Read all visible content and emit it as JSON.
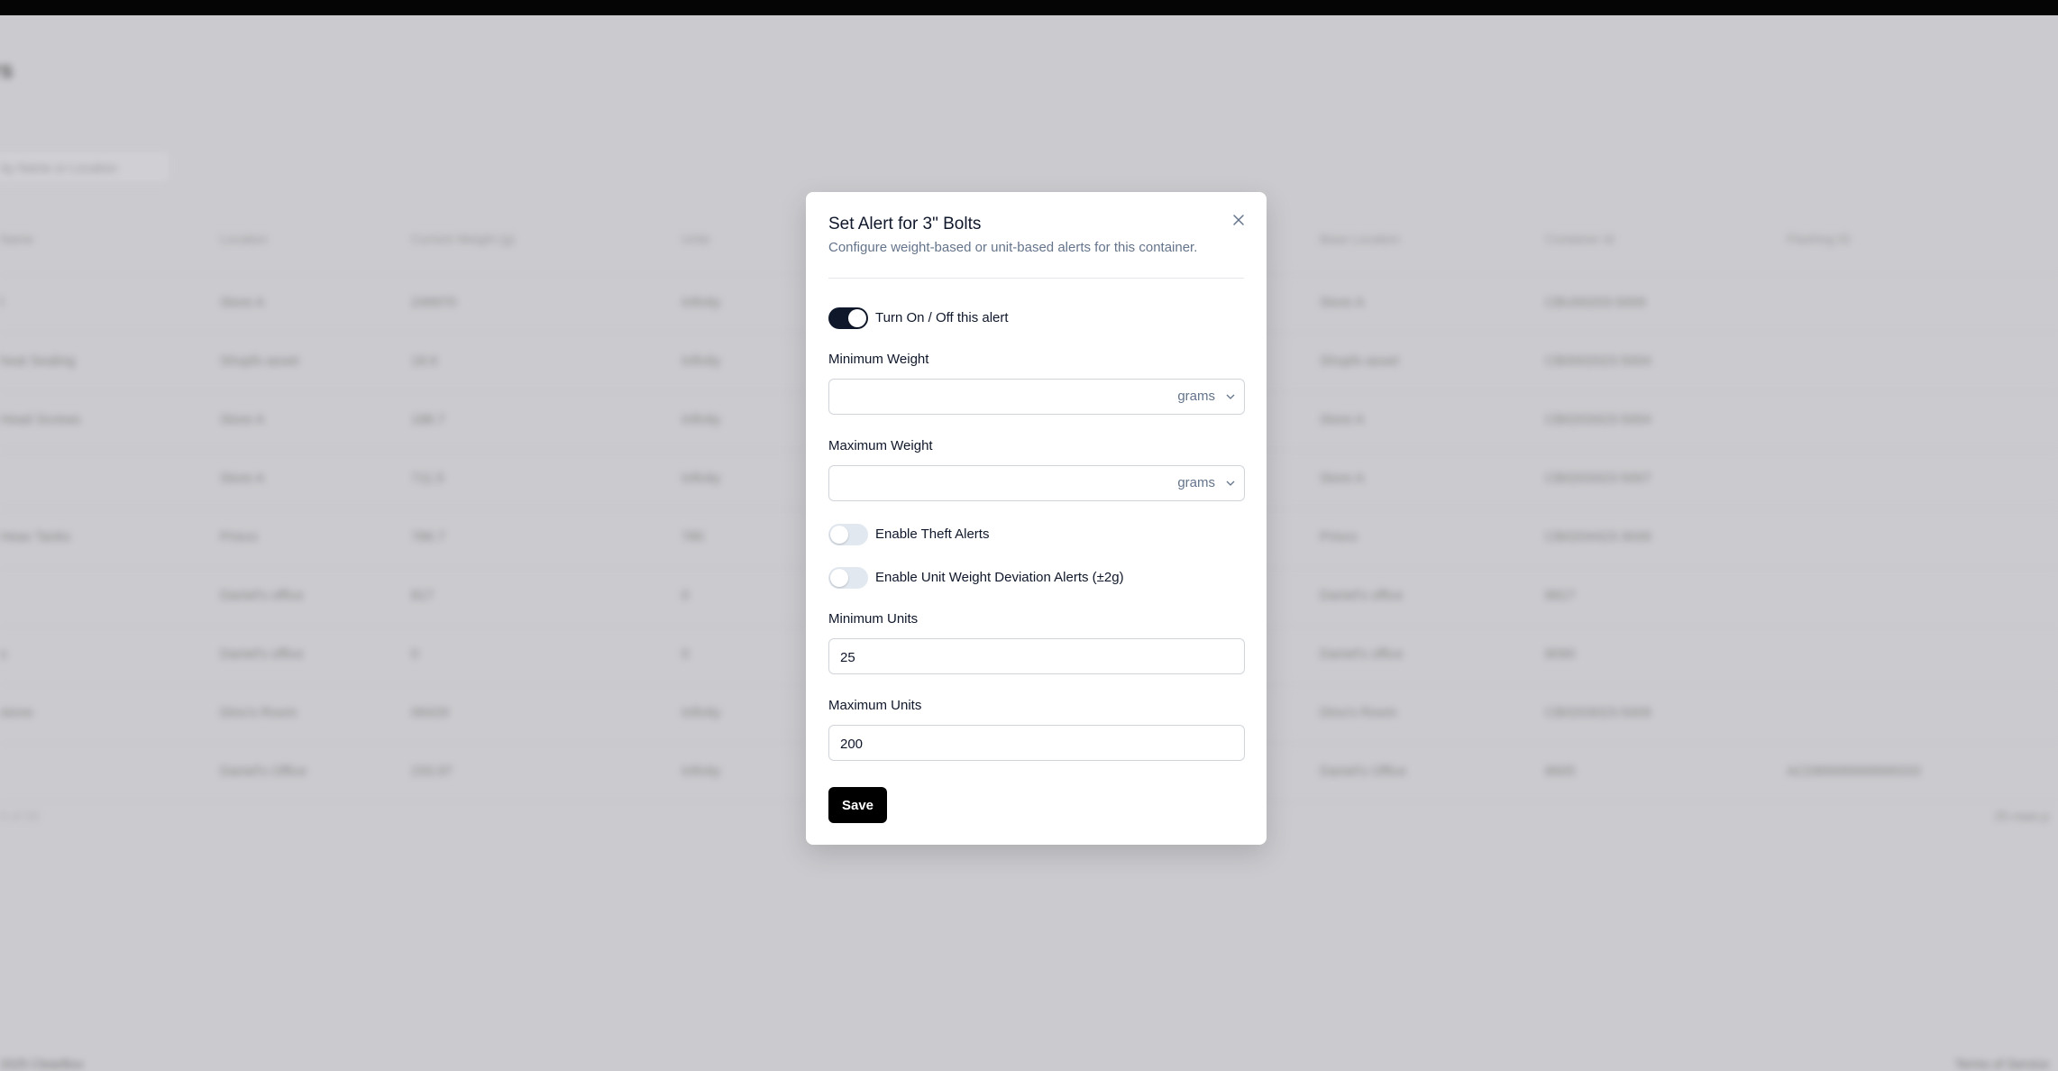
{
  "background": {
    "page_title": "rs",
    "search_placeholder": "by Name or Location",
    "columns": [
      "Name",
      "Location",
      "Current Weight (g)",
      "Units",
      "Base Location",
      "Container Id",
      "Flashing ID"
    ],
    "rows": [
      [
        "l",
        "Store A",
        "249970",
        "Infinity",
        "Store A",
        "CBU00203-5009",
        ""
      ],
      [
        "heat Sealing",
        "Shopfx-asset",
        "18.6",
        "Infinity",
        "Shopfx-asset",
        "CB0002023-5004",
        ""
      ],
      [
        "Head Screws",
        "Store A",
        "188.7",
        "Infinity",
        "Store A",
        "CB0203423-5004",
        ""
      ],
      [
        "",
        "Store A",
        "711.5",
        "Infinity",
        "Store A",
        "CB0203423-5007",
        ""
      ],
      [
        "Heav Tanks",
        "Prisco",
        "786.7",
        "785",
        "Prisco",
        "CB0204423-3049",
        ""
      ],
      [
        "",
        "Daniel's office",
        "817",
        "0",
        "Daniel's office",
        "8817",
        ""
      ],
      [
        "s",
        "Daniel's office",
        "0",
        "0",
        "Daniel's office",
        "8090",
        ""
      ],
      [
        "stone",
        "Dino's Room",
        "06429",
        "Infinity",
        "Dino's Room",
        "CB0203023-5009",
        ""
      ],
      [
        "",
        "Daniel's Office",
        "233.97",
        "Infinity",
        "Daniel's Office",
        "8605",
        "ACD89999999999333"
      ]
    ],
    "footer_left": "0 of 33",
    "footer_right": "25 rows p",
    "copyright": "2025 ClearBox",
    "footer_link": "Terms of Service"
  },
  "modal": {
    "title": "Set Alert for 3\" Bolts",
    "subtitle": "Configure weight-based or unit-based alerts for this container.",
    "alert_toggle": {
      "label": "Turn On / Off this alert",
      "checked": true
    },
    "min_weight": {
      "label": "Minimum Weight",
      "value": "",
      "unit": "grams"
    },
    "max_weight": {
      "label": "Maximum Weight",
      "value": "",
      "unit": "grams"
    },
    "theft_toggle": {
      "label": "Enable Theft Alerts",
      "checked": false
    },
    "deviation_toggle": {
      "label": "Enable Unit Weight Deviation Alerts (±2g)",
      "checked": false
    },
    "min_units": {
      "label": "Minimum Units",
      "value": "25"
    },
    "max_units": {
      "label": "Maximum Units",
      "value": "200"
    },
    "save_label": "Save"
  }
}
